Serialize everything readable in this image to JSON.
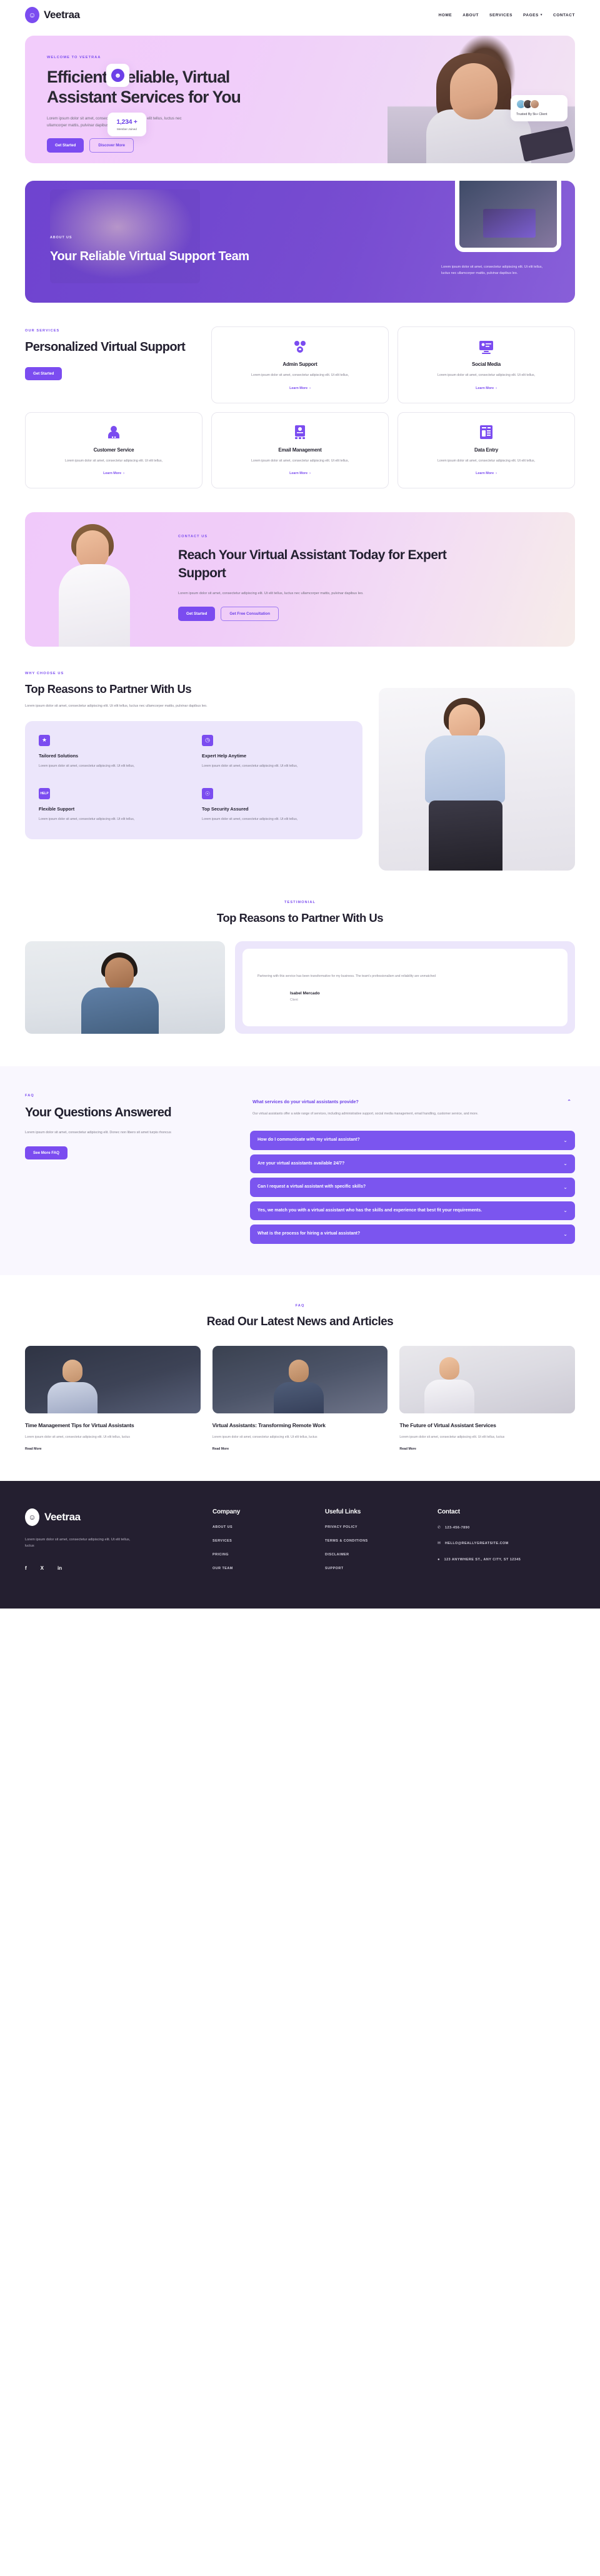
{
  "brand": {
    "name": "Veetraa",
    "logo_icon": "assistant-avatar-icon"
  },
  "nav": {
    "items": [
      {
        "label": "HOME"
      },
      {
        "label": "ABOUT"
      },
      {
        "label": "SERVICES"
      },
      {
        "label": "PAGES",
        "has_caret": true
      },
      {
        "label": "CONTACT"
      }
    ]
  },
  "hero": {
    "eyebrow": "WELCOME TO VEETRAA",
    "title": "Efficient, Reliable, Virtual Assistant Services for You",
    "subtitle": "Lorem ipsum dolor sit amet, consectetur adipiscing elit. Ut elit tellus, luctus nec ullamcorper mattis, pulvinar dapibus leo.",
    "primary_cta": "Get Started",
    "secondary_cta": "Discover More",
    "stat_number": "1,234 +",
    "stat_label": "Member Joined",
    "trust_label": "Trusted By 5k+ Client"
  },
  "about": {
    "eyebrow": "ABOUT US",
    "title": "Your Reliable Virtual Support Team",
    "paragraph": "Lorem ipsum dolor sit amet, consectetur adipiscing elit. Ut elit tellus, luctus nec ullamcorper mattis, pulvinar dapibus leo."
  },
  "services": {
    "eyebrow": "OUR SERVICES",
    "title": "Personalized Virtual Support",
    "cta": "Get Started",
    "learn_more": "Learn More",
    "cards": [
      {
        "icon": "team-chat-icon",
        "title": "Admin Support",
        "desc": "Lorem ipsum dolor sit amet, consectetur adipiscing elit. Ut elit tellus,"
      },
      {
        "icon": "monitor-post-icon",
        "title": "Social Media",
        "desc": "Lorem ipsum dolor sit amet, consectetur adipiscing elit. Ut elit tellus,"
      },
      {
        "icon": "headset-agent-icon",
        "title": "Customer Service",
        "desc": "Lorem ipsum dolor sit amet, consectetur adipiscing elit. Ut elit tellus,"
      },
      {
        "icon": "envelope-device-icon",
        "title": "Email Management",
        "desc": "Lorem ipsum dolor sit amet, consectetur adipiscing elit. Ut elit tellus,"
      },
      {
        "icon": "data-form-icon",
        "title": "Data Entry",
        "desc": "Lorem ipsum dolor sit amet, consectetur adipiscing elit. Ut elit tellus,"
      }
    ]
  },
  "cta": {
    "eyebrow": "CONTACT US",
    "title": "Reach Your Virtual Assistant Today for Expert Support",
    "paragraph": "Lorem ipsum dolor sit amet, consectetur adipiscing elit. Ut elit tellus, luctus nec ullamcorper mattis, pulvinar dapibus leo.",
    "primary_cta": "Get Started",
    "secondary_cta": "Get Free Consultation"
  },
  "why": {
    "eyebrow": "WHY CHOOSE US",
    "title": "Top Reasons to Partner With Us",
    "paragraph": "Lorem ipsum dolor sit amet, consectetur adipiscing elit. Ut elit tellus, luctus nec ullamcorper mattis, pulvinar dapibus leo.",
    "items": [
      {
        "icon": "thumbs-up-stars-icon",
        "title": "Tailored Solutions",
        "desc": "Lorem ipsum dolor sit amet, consectetur adipiscing elit. Ut elit tellus,"
      },
      {
        "icon": "clock-icon",
        "title": "Expert Help Anytime",
        "desc": "Lorem ipsum dolor sit amet, consectetur adipiscing elit. Ut elit tellus,"
      },
      {
        "icon": "help-desk-icon",
        "title": "Flexible Support",
        "desc": "Lorem ipsum dolor sit amet, consectetur adipiscing elit. Ut elit tellus,"
      },
      {
        "icon": "shield-lock-icon",
        "title": "Top Security Assured",
        "desc": "Lorem ipsum dolor sit amet, consectetur adipiscing elit. Ut elit tellus,"
      }
    ]
  },
  "testimonial": {
    "eyebrow": "TESTIMONIAL",
    "title": "Top Reasons to Partner With Us",
    "quote": "Partnering with this service has been transformative for my business. The team's professionalism and reliability are unmatched",
    "author": "Isabel Mercado",
    "role": "Client"
  },
  "faq": {
    "eyebrow": "FAQ",
    "title": "Your Questions Answered",
    "paragraph": "Lorem ipsum dolor sit amet, consectetur adipiscing elit. Donec non libero sit amet turpis rhoncus",
    "cta": "See More FAQ",
    "open_question": "What services do your virtual assistants provide?",
    "open_answer": "Our virtual assistants offer a wide range of services, including administrative support, social media management, email handling, customer service, and more.",
    "items": [
      {
        "q": "How do I communicate with my virtual assistant?"
      },
      {
        "q": "Are your virtual assistants available 24/7?"
      },
      {
        "q": "Can I request a virtual assistant with specific skills?"
      },
      {
        "q": "Yes, we match you with a virtual assistant who has the skills and experience that best fit your requirements."
      },
      {
        "q": "What is the process for hiring a virtual assistant?"
      }
    ]
  },
  "blog": {
    "eyebrow": "FAQ",
    "title": "Read Our Latest News and Articles",
    "read_more": "Read More",
    "posts": [
      {
        "title": "Time Management Tips for Virtual Assistants",
        "desc": "Lorem ipsum dolor sit amet, consectetur adipiscing elit. Ut elit tellus, luctus"
      },
      {
        "title": "Virtual Assistants: Transforming Remote Work",
        "desc": "Lorem ipsum dolor sit amet, consectetur adipiscing elit. Ut elit tellus, luctus"
      },
      {
        "title": "The Future of Virtual Assistant Services",
        "desc": "Lorem ipsum dolor sit amet, consectetur adipiscing elit. Ut elit tellus, luctus"
      }
    ]
  },
  "footer": {
    "brand_name": "Veetraa",
    "desc": "Lorem ipsum dolor sit amet, consectetur adipiscing elit. Ut elit tellus, luctus",
    "social": [
      {
        "icon": "facebook-icon",
        "glyph": "f"
      },
      {
        "icon": "x-twitter-icon",
        "glyph": "X"
      },
      {
        "icon": "linkedin-icon",
        "glyph": "in"
      }
    ],
    "company": {
      "title": "Company",
      "links": [
        {
          "label": "ABOUT US"
        },
        {
          "label": "SERVICES"
        },
        {
          "label": "PRICING"
        },
        {
          "label": "OUR TEAM"
        }
      ]
    },
    "useful": {
      "title": "Useful Links",
      "links": [
        {
          "label": "PRIVACY POLICY"
        },
        {
          "label": "TERMS & CONDITIONS"
        },
        {
          "label": "DISCLAIMER"
        },
        {
          "label": "SUPPORT"
        }
      ]
    },
    "contact": {
      "title": "Contact",
      "items": [
        {
          "icon": "phone-icon",
          "glyph": "✆",
          "text": "123-456-7890"
        },
        {
          "icon": "mail-icon",
          "glyph": "✉",
          "text": "HELLO@REALLYGREATSITE.COM"
        },
        {
          "icon": "location-pin-icon",
          "glyph": "●",
          "text": "123 ANYWHERE ST., ANY CITY, ST 12345"
        }
      ]
    }
  },
  "colors": {
    "accent": "#7b4cf0",
    "accent_dark": "#6c40e8",
    "footer_bg": "#241f30",
    "soft_lilac": "#ece6fb"
  }
}
